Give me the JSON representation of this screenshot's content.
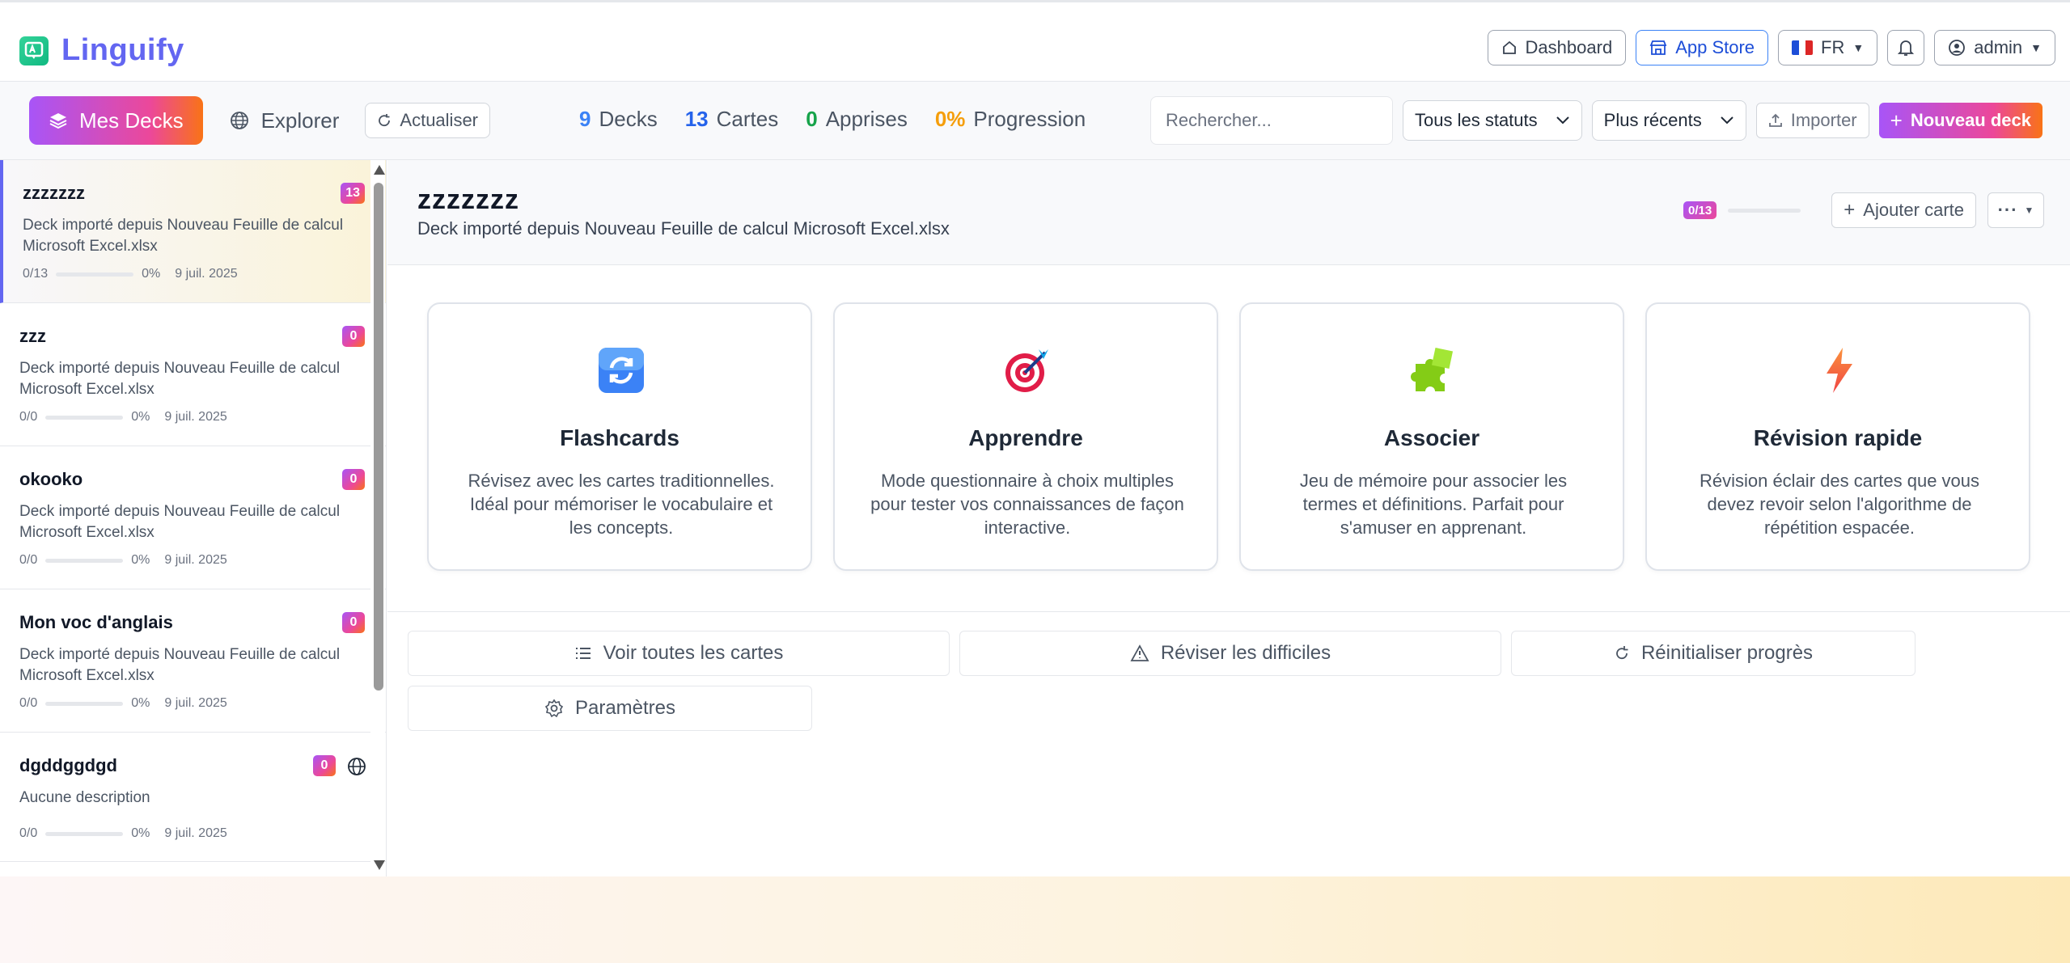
{
  "app": {
    "name": "Linguify"
  },
  "nav": {
    "dashboard": "Dashboard",
    "app_store": "App Store",
    "language": "FR",
    "user": "admin"
  },
  "toolbar": {
    "my_decks": "Mes Decks",
    "explore": "Explorer",
    "refresh": "Actualiser",
    "stats": [
      {
        "value": "9",
        "label": "Decks",
        "color": "#3b82f6"
      },
      {
        "value": "13",
        "label": "Cartes",
        "color": "#2563eb"
      },
      {
        "value": "0",
        "label": "Apprises",
        "color": "#16a34a"
      },
      {
        "value": "0%",
        "label": "Progression",
        "color": "#f59e0b"
      }
    ],
    "search_placeholder": "Rechercher...",
    "status_filter": "Tous les statuts",
    "sort": "Plus récents",
    "import": "Importer",
    "new_deck": "Nouveau deck"
  },
  "decks": [
    {
      "name": "zzzzzzz",
      "count": "13",
      "desc": "Deck importé depuis Nouveau Feuille de calcul Microsoft Excel.xlsx",
      "progress": "0/13",
      "percent": "0%",
      "date": "9 juil. 2025",
      "active": true
    },
    {
      "name": "zzz",
      "count": "0",
      "desc": "Deck importé depuis Nouveau Feuille de calcul Microsoft Excel.xlsx",
      "progress": "0/0",
      "percent": "0%",
      "date": "9 juil. 2025"
    },
    {
      "name": "okooko",
      "count": "0",
      "desc": "Deck importé depuis Nouveau Feuille de calcul Microsoft Excel.xlsx",
      "progress": "0/0",
      "percent": "0%",
      "date": "9 juil. 2025"
    },
    {
      "name": "Mon voc d'anglais",
      "count": "0",
      "desc": "Deck importé depuis Nouveau Feuille de calcul Microsoft Excel.xlsx",
      "progress": "0/0",
      "percent": "0%",
      "date": "9 juil. 2025"
    },
    {
      "name": "dgddggdgd",
      "count": "0",
      "desc": "Aucune description",
      "progress": "0/0",
      "percent": "0%",
      "date": "9 juil. 2025",
      "public": true
    }
  ],
  "deck_detail": {
    "title": "zzzzzzz",
    "subtitle": "Deck importé depuis Nouveau Feuille de calcul Microsoft Excel.xlsx",
    "progress_pill": "0/13",
    "add_card": "Ajouter carte"
  },
  "modes": [
    {
      "title": "Flashcards",
      "desc": "Révisez avec les cartes traditionnelles. Idéal pour mémoriser le vocabulaire et les concepts.",
      "icon": "flashcards-icon"
    },
    {
      "title": "Apprendre",
      "desc": "Mode questionnaire à choix multiples pour tester vos connaissances de façon interactive.",
      "icon": "target-icon"
    },
    {
      "title": "Associer",
      "desc": "Jeu de mémoire pour associer les termes et définitions. Parfait pour s'amuser en apprenant.",
      "icon": "puzzle-icon"
    },
    {
      "title": "Révision rapide",
      "desc": "Révision éclair des cartes que vous devez revoir selon l'algorithme de répétition espacée.",
      "icon": "lightning-icon"
    }
  ],
  "actions": {
    "view_all": "Voir toutes les cartes",
    "review_hard": "Réviser les difficiles",
    "reset": "Réinitialiser progrès",
    "settings": "Paramètres"
  }
}
